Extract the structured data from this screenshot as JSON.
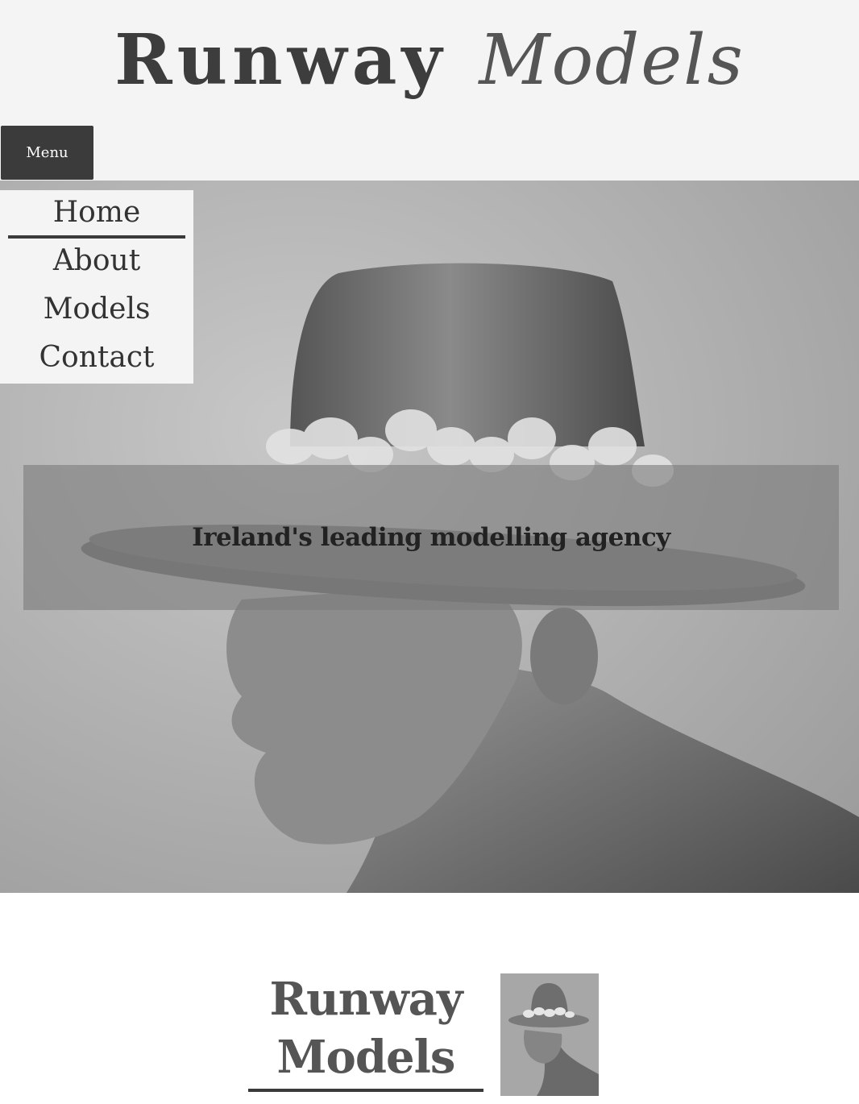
{
  "header": {
    "title_word1": "Runway",
    "title_word2": "Models"
  },
  "menu_button": {
    "label": "Menu"
  },
  "nav": {
    "items": [
      "Home",
      "About",
      "Models",
      "Contact"
    ],
    "active": "Home"
  },
  "hero": {
    "tagline": "Ireland's leading modelling agency"
  },
  "footer_logo": {
    "line1": "Runway",
    "line2": "Models"
  },
  "colors": {
    "dark": "#3b3b3b",
    "background": "#f4f4f4",
    "overlay": "#7d7d7d"
  }
}
